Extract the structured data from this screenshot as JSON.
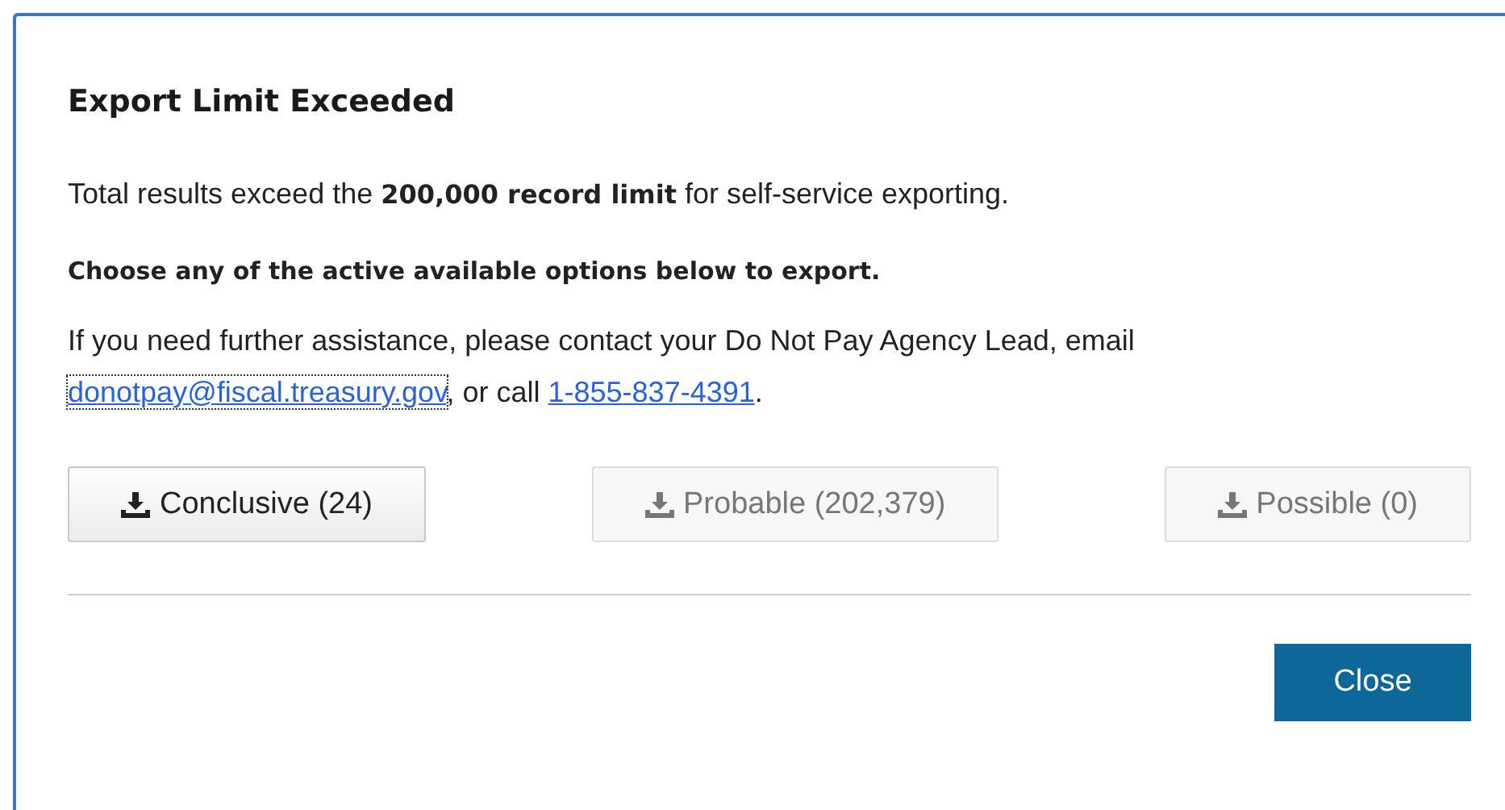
{
  "dialog": {
    "title": "Export Limit Exceeded",
    "message": "Total results exceed the **200,000 record limit** for self-service exporting.",
    "instruction": "Choose any of the active available options below to export.",
    "contact": {
      "before": "If you need further assistance, please contact your Do Not Pay Agency Lead, email ",
      "email": {
        "text": "donotpay@fiscal.treasury.gov",
        "focused": true
      },
      "middle": ", or call ",
      "phone": {
        "text": "1-855-837-4391",
        "focused": false
      },
      "after": "."
    },
    "export_buttons": [
      {
        "label": "Conclusive (24)",
        "disabled": false
      },
      {
        "label": "Probable (202,379)",
        "disabled": true
      },
      {
        "label": "Possible (0)",
        "disabled": true
      }
    ],
    "close_button": "Close"
  }
}
